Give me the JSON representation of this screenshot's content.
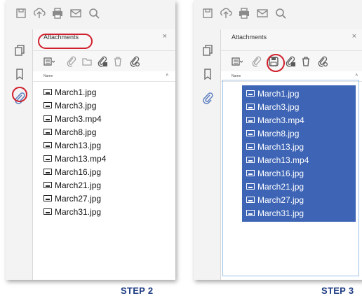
{
  "colors": {
    "highlight": "#d1202d",
    "selection": "#3d64b5",
    "step_text": "#1e3c82",
    "icon_gray": "#8a8a8a"
  },
  "panels": [
    {
      "attachments_title": "Attachments",
      "close_label": "×",
      "column_header": "Name",
      "files": [
        "March1.jpg",
        "March3.jpg",
        "March3.mp4",
        "March8.jpg",
        "March13.jpg",
        "March13.mp4",
        "March16.jpg",
        "March21.jpg",
        "March27.jpg",
        "March31.jpg"
      ],
      "step_label": "STEP 2",
      "highlighted": [
        "attachments-title",
        "attachment-sidebar-icon"
      ],
      "selection": "none"
    },
    {
      "attachments_title": "Attachments",
      "close_label": "×",
      "column_header": "Name",
      "files": [
        "March1.jpg",
        "March3.jpg",
        "March3.mp4",
        "March8.jpg",
        "March13.jpg",
        "March13.mp4",
        "March16.jpg",
        "March21.jpg",
        "March27.jpg",
        "March31.jpg"
      ],
      "step_label": "STEP 3",
      "highlighted": [
        "save-attachment-icon"
      ],
      "selection": "all"
    }
  ],
  "icons": {
    "toolbar": [
      "save-icon",
      "upload-icon",
      "print-icon",
      "email-icon",
      "zoom-icon"
    ],
    "sidebar": [
      "pages-icon",
      "bookmark-icon",
      "attachment-icon"
    ],
    "attachment_tools": [
      "options-dropdown-icon",
      "add-attachment-icon",
      "open-attachment-icon",
      "save-attachment-icon",
      "delete-attachment-icon",
      "search-attachment-icon"
    ]
  }
}
